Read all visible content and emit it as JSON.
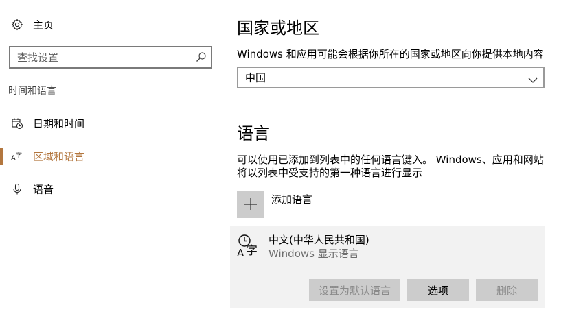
{
  "sidebar": {
    "home_label": "主页",
    "search_placeholder": "查找设置",
    "section_heading": "时间和语言",
    "items": [
      {
        "label": "日期和时间",
        "icon": "calendar-clock-icon",
        "active": false
      },
      {
        "label": "区域和语言",
        "icon": "language-icon",
        "active": true
      },
      {
        "label": "语音",
        "icon": "microphone-icon",
        "active": false
      }
    ]
  },
  "region": {
    "title": "国家或地区",
    "description": "Windows 和应用可能会根据你所在的国家或地区向你提供本地内容",
    "selected_country": "中国"
  },
  "language": {
    "title": "语言",
    "description_line1": "可以使用已添加到列表中的任何语言键入。 Windows、应用和网站",
    "description_line2": "将以列表中受支持的第一种语言进行显示",
    "add_label": "添加语言",
    "entry": {
      "name": "中文(中华人民共和国)",
      "subtitle": "Windows 显示语言"
    },
    "buttons": {
      "set_default": "设置为默认语言",
      "options": "选项",
      "remove": "删除"
    }
  },
  "colors": {
    "accent": "#b3773f",
    "card_bg": "#f2f2f2",
    "button_bg": "#cccccc",
    "disabled_text": "#8a8a8a"
  }
}
